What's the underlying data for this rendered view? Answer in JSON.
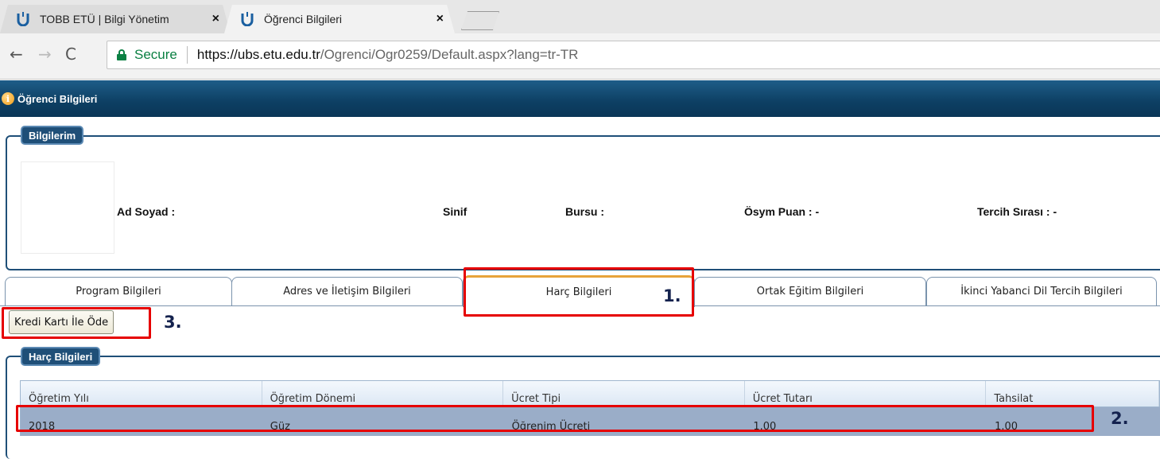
{
  "browser": {
    "tabs": [
      {
        "title": "TOBB ETÜ | Bilgi Yönetim",
        "close": "×"
      },
      {
        "title": "Öğrenci Bilgileri",
        "close": "×"
      }
    ],
    "nav": {
      "back": "←",
      "forward": "→",
      "reload": "C"
    },
    "address": {
      "secure_label": "Secure",
      "separator": "|",
      "url_scheme_host": "https://ubs.etu.edu.tr",
      "url_path": "/Ogrenci/Ogr0259/Default.aspx?lang=tr-TR"
    }
  },
  "page": {
    "title": "Öğrenci Bilgileri",
    "info_icon": "info-icon"
  },
  "bilgilerim": {
    "legend": "Bilgilerim",
    "ad_soyad_label": "Ad Soyad :",
    "sinif_label": "Sinif :",
    "bursu_label": "Bursu :",
    "osym_label": "Ösym Puan : -",
    "tercih_label": "Tercih Sırası : -"
  },
  "tabs": [
    {
      "label": "Program Bilgileri"
    },
    {
      "label": "Adres ve İletişim Bilgileri"
    },
    {
      "label": "Harç Bilgileri"
    },
    {
      "label": "Ortak Eğitim Bilgileri"
    },
    {
      "label": "İkinci Yabanci Dil Tercih Bilgileri"
    }
  ],
  "pay_button": "Kredi Kartı İle Öde",
  "annotations": {
    "one": "1.",
    "two": "2.",
    "three": "3."
  },
  "harc": {
    "legend": "Harç Bilgileri",
    "columns": [
      "Öğretim Yılı",
      "Öğretim Dönemi",
      "Ücret Tipi",
      "Ücret Tutarı",
      "Tahsilat"
    ],
    "rows": [
      [
        "2018",
        "Güz",
        "Öğrenim Ücreti",
        "1.00",
        "1.00"
      ]
    ]
  },
  "colors": {
    "header_blue": "#0d3f63",
    "annotation_red": "#e60000",
    "active_tab_accent": "#e8a33a",
    "selected_row": "#9aadc8"
  }
}
